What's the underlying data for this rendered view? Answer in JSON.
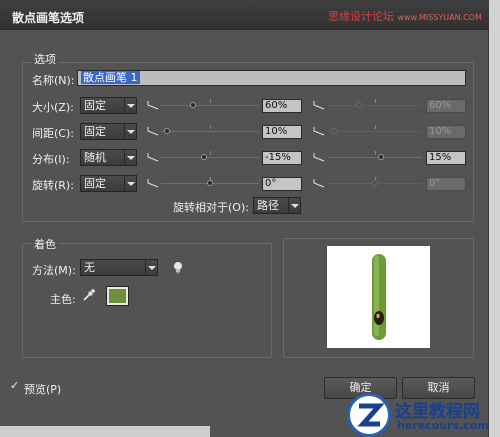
{
  "window": {
    "title": "散点画笔选项",
    "watermark": "思缘设计论坛",
    "watermark_url": "www.MISSYUAN.COM"
  },
  "options_group": {
    "label": "选项",
    "name_label": "名称(N):",
    "name_value": "散点画笔 1",
    "rows": [
      {
        "label": "大小(Z):",
        "mode": "固定",
        "value": "60%",
        "value2": "60%",
        "pos": 0.32,
        "pos2": 0.32,
        "dim2": true
      },
      {
        "label": "间距(C):",
        "mode": "固定",
        "value": "10%",
        "value2": "10%",
        "pos": 0.03,
        "pos2": 0.03,
        "dim2": true
      },
      {
        "label": "分布(I):",
        "mode": "随机",
        "value": "-15%",
        "value2": "15%",
        "pos": 0.43,
        "pos2": 0.57,
        "dim2": false
      },
      {
        "label": "旋转(R):",
        "mode": "固定",
        "value": "0°",
        "value2": "0°",
        "pos": 0.5,
        "pos2": 0.5,
        "dim2": true
      }
    ],
    "rotate_relative_label": "旋转相对于(O):",
    "rotate_relative_value": "路径"
  },
  "coloring_group": {
    "label": "着色",
    "method_label": "方法(M):",
    "method_value": "无",
    "key_color_label": "主色:",
    "key_color": "#6b8f3a"
  },
  "preview": {
    "checkbox_label": "预览(P)",
    "checked": true
  },
  "buttons": {
    "ok": "确定",
    "cancel": "取消"
  },
  "badge": {
    "title": "这里教程网",
    "url": "herecours.com"
  }
}
